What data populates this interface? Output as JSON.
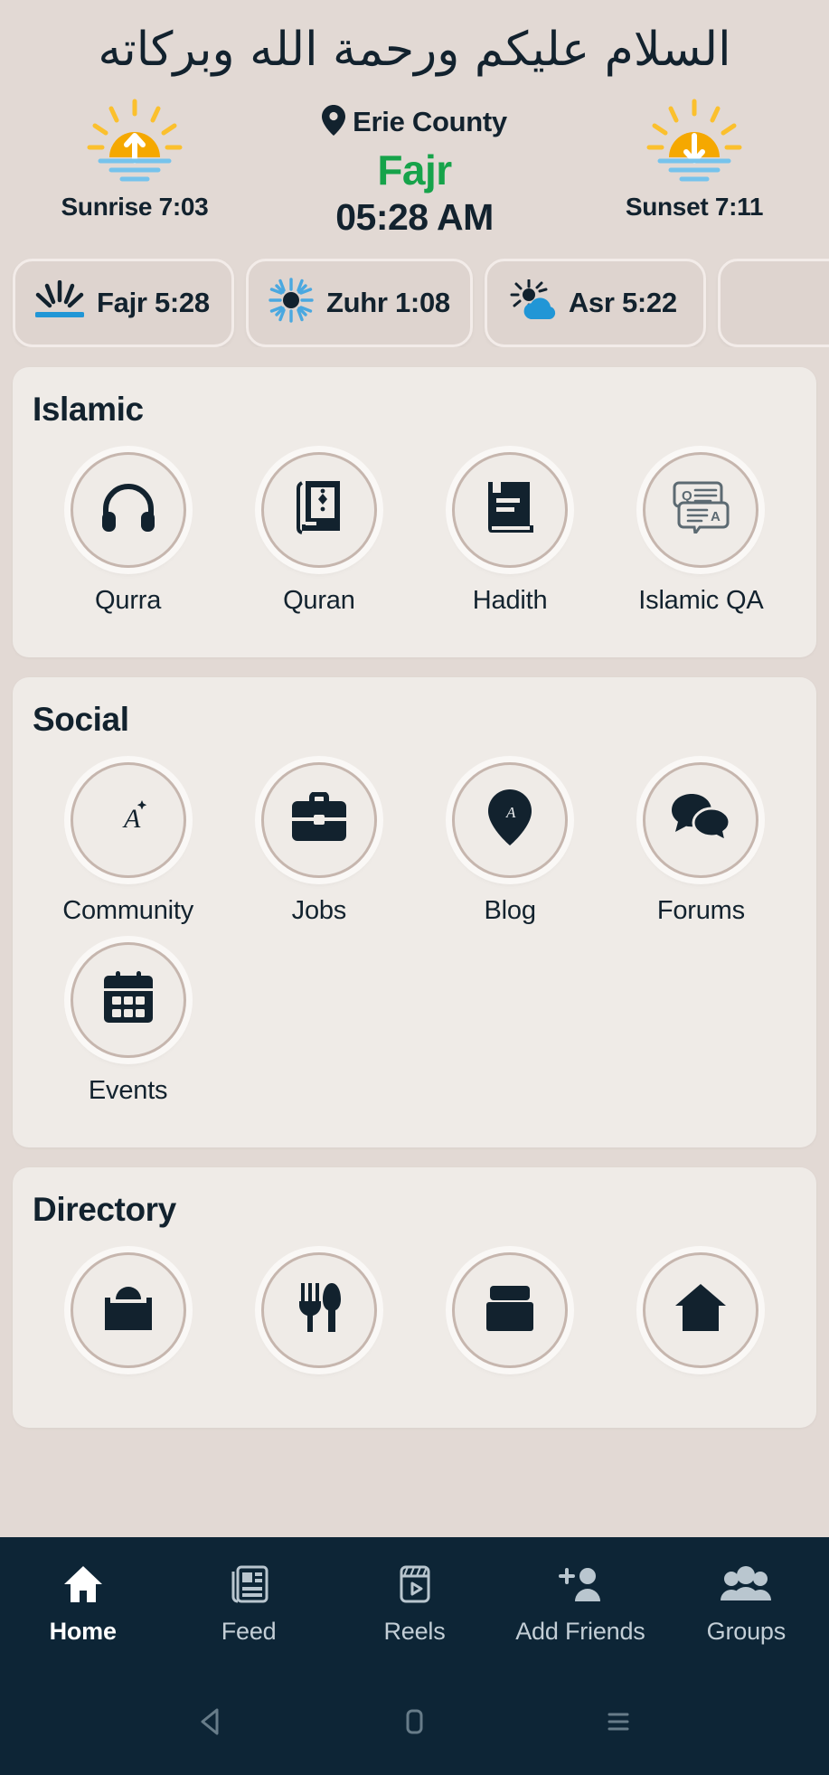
{
  "greeting": "السلام عليكم ورحمة الله وبركاته",
  "header": {
    "sunrise": {
      "label": "Sunrise 7:03",
      "icon": "sunrise-icon"
    },
    "sunset": {
      "label": "Sunset 7:11",
      "icon": "sunset-icon"
    },
    "location": {
      "name": "Erie County",
      "icon": "location-pin-icon"
    },
    "current_prayer": "Fajr",
    "current_time": "05:28 AM",
    "accent_green": "#16a34a",
    "dark": "#12222e"
  },
  "prayer_chips": [
    {
      "label": "Fajr 5:28",
      "icon": "sunrise-rays-icon"
    },
    {
      "label": "Zuhr 1:08",
      "icon": "sun-icon"
    },
    {
      "label": "Asr 5:22",
      "icon": "sun-cloud-icon"
    },
    {
      "label": "",
      "icon": "partial-chip"
    }
  ],
  "sections": [
    {
      "title": "Islamic",
      "tiles": [
        {
          "label": "Qurra",
          "icon": "headphones-icon"
        },
        {
          "label": "Quran",
          "icon": "quran-book-icon"
        },
        {
          "label": "Hadith",
          "icon": "book-icon"
        },
        {
          "label": "Islamic QA",
          "icon": "qa-chat-icon"
        }
      ]
    },
    {
      "title": "Social",
      "tiles": [
        {
          "label": "Community",
          "icon": "crescent-a-icon"
        },
        {
          "label": "Jobs",
          "icon": "briefcase-icon"
        },
        {
          "label": "Blog",
          "icon": "map-pin-crescent-icon"
        },
        {
          "label": "Forums",
          "icon": "chat-bubbles-icon"
        },
        {
          "label": "Events",
          "icon": "calendar-icon"
        }
      ]
    },
    {
      "title": "Directory",
      "tiles": [
        {
          "label": "",
          "icon": "mosque-icon"
        },
        {
          "label": "",
          "icon": "restaurant-icon"
        },
        {
          "label": "",
          "icon": "store-icon"
        },
        {
          "label": "",
          "icon": "home-icon"
        }
      ]
    }
  ],
  "bottom_nav": [
    {
      "label": "Home",
      "icon": "home-icon",
      "active": true
    },
    {
      "label": "Feed",
      "icon": "feed-icon",
      "active": false
    },
    {
      "label": "Reels",
      "icon": "reels-icon",
      "active": false
    },
    {
      "label": "Add Friends",
      "icon": "add-friends-icon",
      "active": false
    },
    {
      "label": "Groups",
      "icon": "groups-icon",
      "active": false
    }
  ],
  "system_nav": [
    {
      "icon": "back-triangle-icon"
    },
    {
      "icon": "home-square-icon"
    },
    {
      "icon": "recents-lines-icon"
    }
  ]
}
